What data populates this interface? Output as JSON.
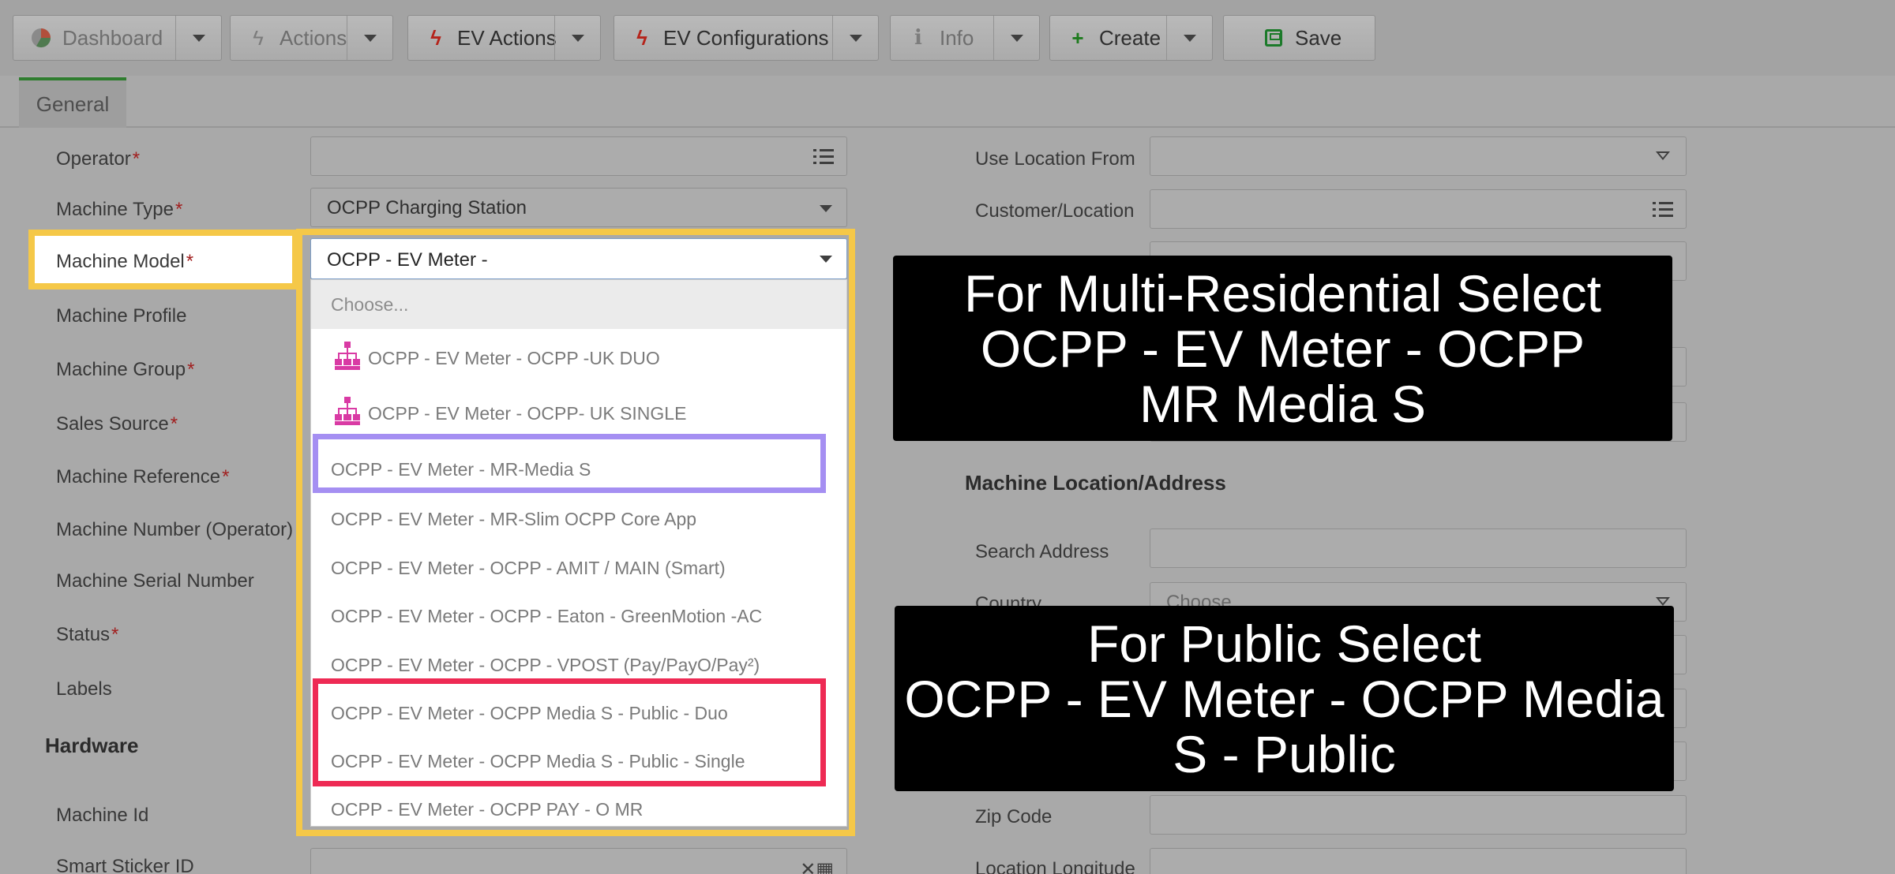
{
  "toolbar": {
    "buttons": [
      {
        "label": "Dashboard",
        "icon": "pie-chart-icon"
      },
      {
        "label": "Actions",
        "icon": "bolt-icon"
      },
      {
        "label": "EV Actions",
        "icon": "bolt-icon"
      },
      {
        "label": "EV Configurations",
        "icon": "bolt-icon"
      },
      {
        "label": "Info",
        "icon": "info-icon"
      },
      {
        "label": "Create",
        "icon": "plus-icon"
      },
      {
        "label": "Save",
        "icon": "save-icon"
      }
    ]
  },
  "tabs": [
    {
      "label": "General"
    }
  ],
  "form": {
    "left_labels": {
      "operator": "Operator",
      "machine_type": "Machine Type",
      "machine_model": "Machine Model",
      "machine_profile": "Machine Profile",
      "machine_group": "Machine Group",
      "sales_source": "Sales Source",
      "machine_reference": "Machine Reference",
      "machine_number": "Machine Number (Operator)",
      "machine_serial": "Machine Serial Number",
      "status": "Status",
      "labels": "Labels",
      "machine_id": "Machine Id",
      "smart_sticker": "Smart Sticker ID"
    },
    "required_mark": "*",
    "hardware_heading": "Hardware",
    "machine_type_value": "OCPP Charging Station",
    "machine_model_value": "OCPP - EV Meter -",
    "right_labels": {
      "use_location_from": "Use Location From",
      "customer_location": "Customer/Location",
      "search_address": "Search Address",
      "country": "Country",
      "zip_code": "Zip Code",
      "location_longitude": "Location Longitude"
    },
    "location_heading": "Machine Location/Address",
    "country_value": "Choose"
  },
  "dropdown": {
    "placeholder": "Choose...",
    "options": [
      "OCPP - EV Meter - OCPP -UK DUO",
      "OCPP - EV Meter - OCPP- UK SINGLE",
      "OCPP - EV Meter - MR-Media S",
      "OCPP - EV Meter - MR-Slim OCPP Core App",
      "OCPP - EV Meter - OCPP - AMIT / MAIN (Smart)",
      "OCPP - EV Meter - OCPP - Eaton - GreenMotion -AC",
      "OCPP - EV Meter - OCPP - VPOST (Pay/PayO/Pay²)",
      "OCPP - EV Meter - OCPP Media S - Public - Duo",
      "OCPP - EV Meter - OCPP Media S - Public - Single",
      "OCPP - EV Meter - OCPP PAY - O MR"
    ]
  },
  "callouts": {
    "multi_residential": [
      "For Multi-Residential Select",
      "OCPP - EV Meter - OCPP",
      "MR Media S"
    ],
    "public": [
      "For Public Select",
      "OCPP - EV Meter - OCPP Media",
      "S - Public"
    ]
  },
  "colors": {
    "highlight_yellow": "#f5c848",
    "highlight_purple": "#a58ff2",
    "highlight_red": "#ee2a54",
    "callout_bg": "#000000"
  }
}
